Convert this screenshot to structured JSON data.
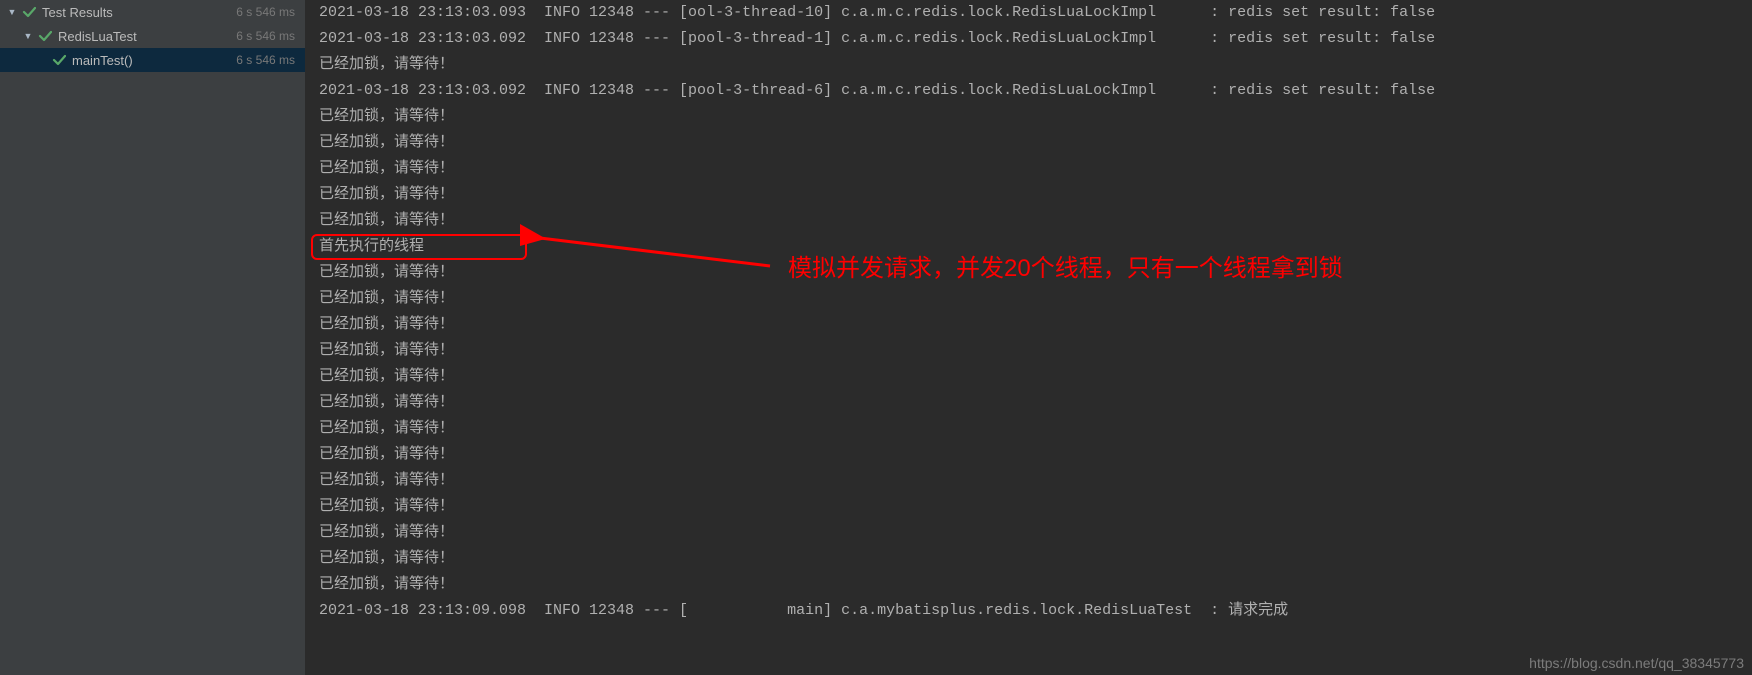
{
  "tree": {
    "root": {
      "label": "Test Results",
      "time": "6 s 546 ms"
    },
    "class": {
      "label": "RedisLuaTest",
      "time": "6 s 546 ms"
    },
    "method": {
      "label": "mainTest()",
      "time": "6 s 546 ms"
    }
  },
  "console": {
    "lines": [
      "2021-03-18 23:13:03.093  INFO 12348 --- [ool-3-thread-10] c.a.m.c.redis.lock.RedisLuaLockImpl      : redis set result: false",
      "2021-03-18 23:13:03.092  INFO 12348 --- [pool-3-thread-1] c.a.m.c.redis.lock.RedisLuaLockImpl      : redis set result: false",
      "已经加锁，请等待！",
      "2021-03-18 23:13:03.092  INFO 12348 --- [pool-3-thread-6] c.a.m.c.redis.lock.RedisLuaLockImpl      : redis set result: false",
      "已经加锁，请等待！",
      "已经加锁，请等待！",
      "已经加锁，请等待！",
      "已经加锁，请等待！",
      "已经加锁，请等待！",
      "首先执行的线程",
      "已经加锁，请等待！",
      "已经加锁，请等待！",
      "已经加锁，请等待！",
      "已经加锁，请等待！",
      "已经加锁，请等待！",
      "已经加锁，请等待！",
      "已经加锁，请等待！",
      "已经加锁，请等待！",
      "已经加锁，请等待！",
      "已经加锁，请等待！",
      "已经加锁，请等待！",
      "已经加锁，请等待！",
      "已经加锁，请等待！",
      "2021-03-18 23:13:09.098  INFO 12348 --- [           main] c.a.mybatisplus.redis.lock.RedisLuaTest  : 请求完成"
    ]
  },
  "annotation": {
    "text": "模拟并发请求，并发20个线程，只有一个线程拿到锁"
  },
  "watermark": "https://blog.csdn.net/qq_38345773"
}
